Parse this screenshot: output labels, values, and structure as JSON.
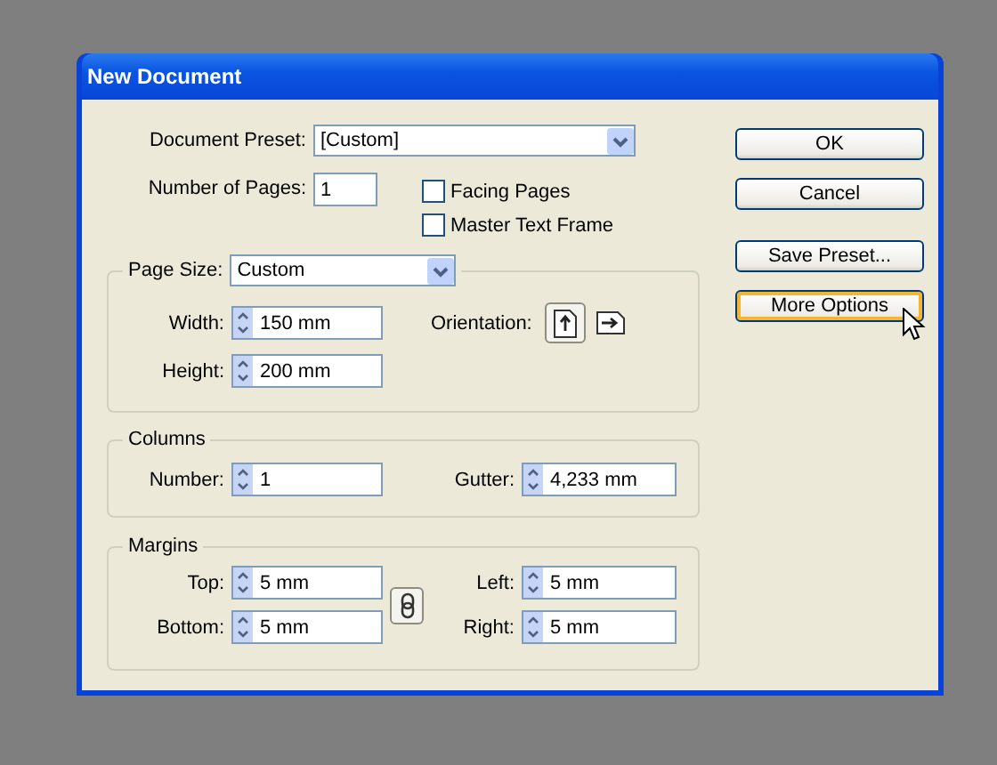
{
  "window": {
    "title": "New Document"
  },
  "document_preset": {
    "label": "Document Preset:",
    "value": "[Custom]"
  },
  "number_of_pages": {
    "label": "Number of Pages:",
    "value": "1"
  },
  "checkboxes": [
    {
      "label": "Facing Pages",
      "checked": false
    },
    {
      "label": "Master Text Frame",
      "checked": false
    }
  ],
  "page_size": {
    "label": "Page Size:",
    "value": "Custom",
    "fields": [
      {
        "label": "Width:",
        "value": "150 mm"
      },
      {
        "label": "Height:",
        "value": "200 mm"
      }
    ],
    "orientation": {
      "label": "Orientation:",
      "options": [
        {
          "kind": "portrait",
          "selected": true
        },
        {
          "kind": "landscape",
          "selected": false
        }
      ]
    }
  },
  "columns": {
    "title": "Columns",
    "number": {
      "label": "Number:",
      "value": "1"
    },
    "gutter": {
      "label": "Gutter:",
      "value": "4,233 mm"
    }
  },
  "margins": {
    "title": "Margins",
    "fields": [
      {
        "label": "Top:",
        "value": "5 mm"
      },
      {
        "label": "Left:",
        "value": "5 mm"
      },
      {
        "label": "Bottom:",
        "value": "5 mm"
      },
      {
        "label": "Right:",
        "value": "5 mm"
      }
    ]
  },
  "buttons": [
    {
      "label": "OK",
      "focused": false
    },
    {
      "label": "Cancel",
      "focused": false
    },
    {
      "label": "Save Preset...",
      "focused": false
    },
    {
      "label": "More Options",
      "focused": true
    }
  ]
}
